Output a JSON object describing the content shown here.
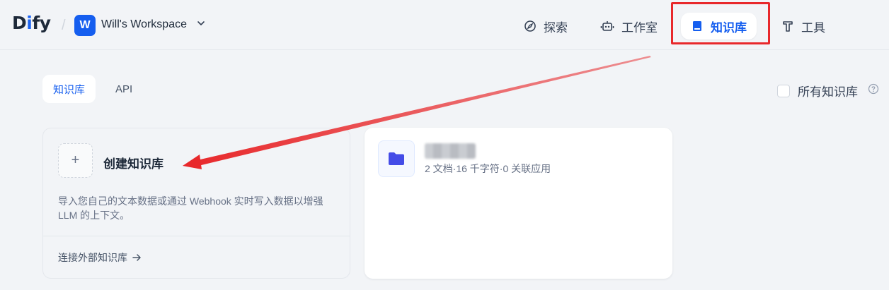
{
  "header": {
    "logo_text": "Dify",
    "workspace": {
      "initial": "W",
      "name": "Will's Workspace"
    },
    "nav": {
      "explore": "探索",
      "studio": "工作室",
      "datasets": "知识库",
      "tools": "工具"
    }
  },
  "tabs": {
    "datasets": "知识库",
    "api": "API"
  },
  "filter": {
    "all_datasets_label": "所有知识库"
  },
  "create_card": {
    "title": "创建知识库",
    "description": "导入您自己的文本数据或通过 Webhook 实时写入数据以增强 LLM 的上下文。",
    "external_link": "连接外部知识库"
  },
  "dataset_card": {
    "meta": "2 文档·16 千字符·0 关联应用"
  },
  "colors": {
    "accent": "#155eef",
    "annotation_red": "#e8282b",
    "folder": "#444ce7"
  }
}
